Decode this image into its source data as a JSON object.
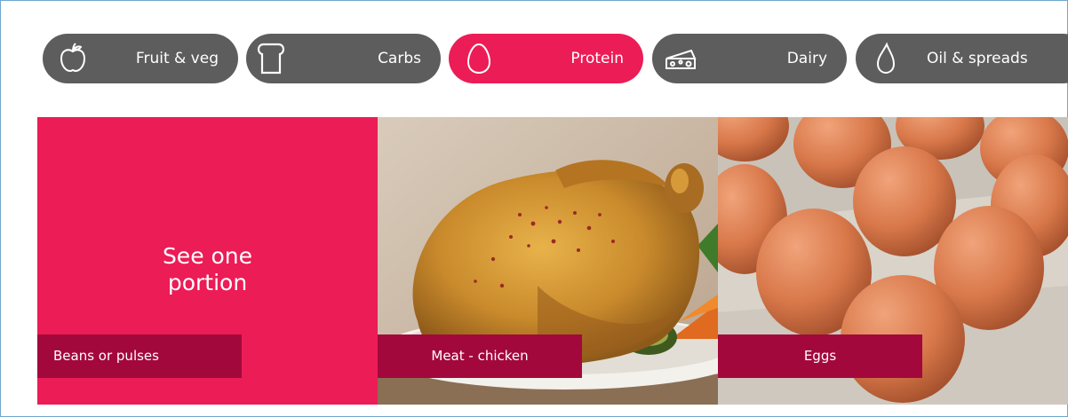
{
  "tabs": [
    {
      "label": "Fruit & veg",
      "icon": "apple-icon",
      "active": false
    },
    {
      "label": "Carbs",
      "icon": "bread-icon",
      "active": false
    },
    {
      "label": "Protein",
      "icon": "egg-icon",
      "active": true
    },
    {
      "label": "Dairy",
      "icon": "cheese-icon",
      "active": false
    },
    {
      "label": "Oil & spreads",
      "icon": "oil-drop-icon",
      "active": false
    }
  ],
  "portion": {
    "text_line1": "See one",
    "text_line2": "portion"
  },
  "tiles": [
    {
      "caption": "Beans or pulses",
      "image": "none"
    },
    {
      "caption": "Meat - chicken",
      "image": "roast-chicken-photo"
    },
    {
      "caption": "Eggs",
      "image": "eggs-carton-photo"
    }
  ],
  "colors": {
    "accent": "#ec1c56",
    "caption_bg": "#a3083c",
    "tab_inactive": "#5d5d5d",
    "frame_border": "#6fa6cf"
  }
}
